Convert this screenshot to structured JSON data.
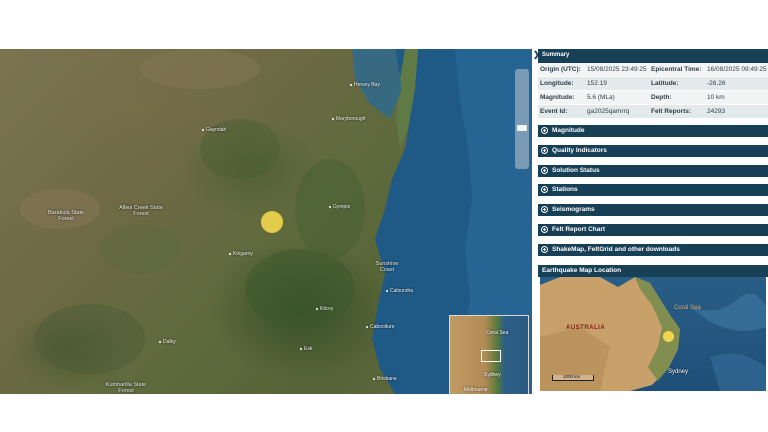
{
  "map": {
    "places": [
      {
        "name": "Hervey Bay"
      },
      {
        "name": "Maryborough"
      },
      {
        "name": "Gayndah"
      },
      {
        "name": "Gympie"
      },
      {
        "name": "Kingaroy"
      },
      {
        "name": "Sunshine Coast"
      },
      {
        "name": "Caloundra"
      },
      {
        "name": "Kilcoy"
      },
      {
        "name": "Caboolture"
      },
      {
        "name": "Dalby"
      },
      {
        "name": "Esk"
      },
      {
        "name": "Brisbane"
      }
    ],
    "regions": [
      {
        "name": "Barakula State Forest"
      },
      {
        "name": "Allies Creek State Forest"
      },
      {
        "name": "Kumbarilla State Forest"
      }
    ],
    "epicentre_color": "#f2d64e",
    "overview": {
      "sea_label": "Coral Sea",
      "city1": "Sydney",
      "city2": "Melbourne"
    }
  },
  "panel": {
    "summary_title": "Summary",
    "rows": [
      {
        "k1": "Origin (UTC):",
        "v1": "15/08/2025 23:49:25",
        "k2": "Epicentral Time:",
        "v2": "16/08/2025 09:49:25"
      },
      {
        "k1": "Longitude:",
        "v1": "152.19",
        "k2": "Latitude:",
        "v2": "-26.26"
      },
      {
        "k1": "Magnitude:",
        "v1": "5.6 (MLa)",
        "k2": "Depth:",
        "v2": "10 km"
      },
      {
        "k1": "Event Id:",
        "v1": "ga2025qamrrq",
        "k2": "Felt Reports:",
        "v2": "24293"
      }
    ],
    "sections": [
      "Magnitude",
      "Quality Indicators",
      "Solution Status",
      "Stations",
      "Seismograms",
      "Felt Report Chart",
      "ShakeMap, FeltGrid and other downloads"
    ],
    "location_title": "Earthquake Map Location",
    "location_map": {
      "country": "AUSTRALIA",
      "sea": "Coral Sea",
      "city": "Sydney",
      "scale": "1000 km"
    }
  },
  "colors": {
    "header": "#173f55",
    "epicentre": "#f2d64e"
  }
}
